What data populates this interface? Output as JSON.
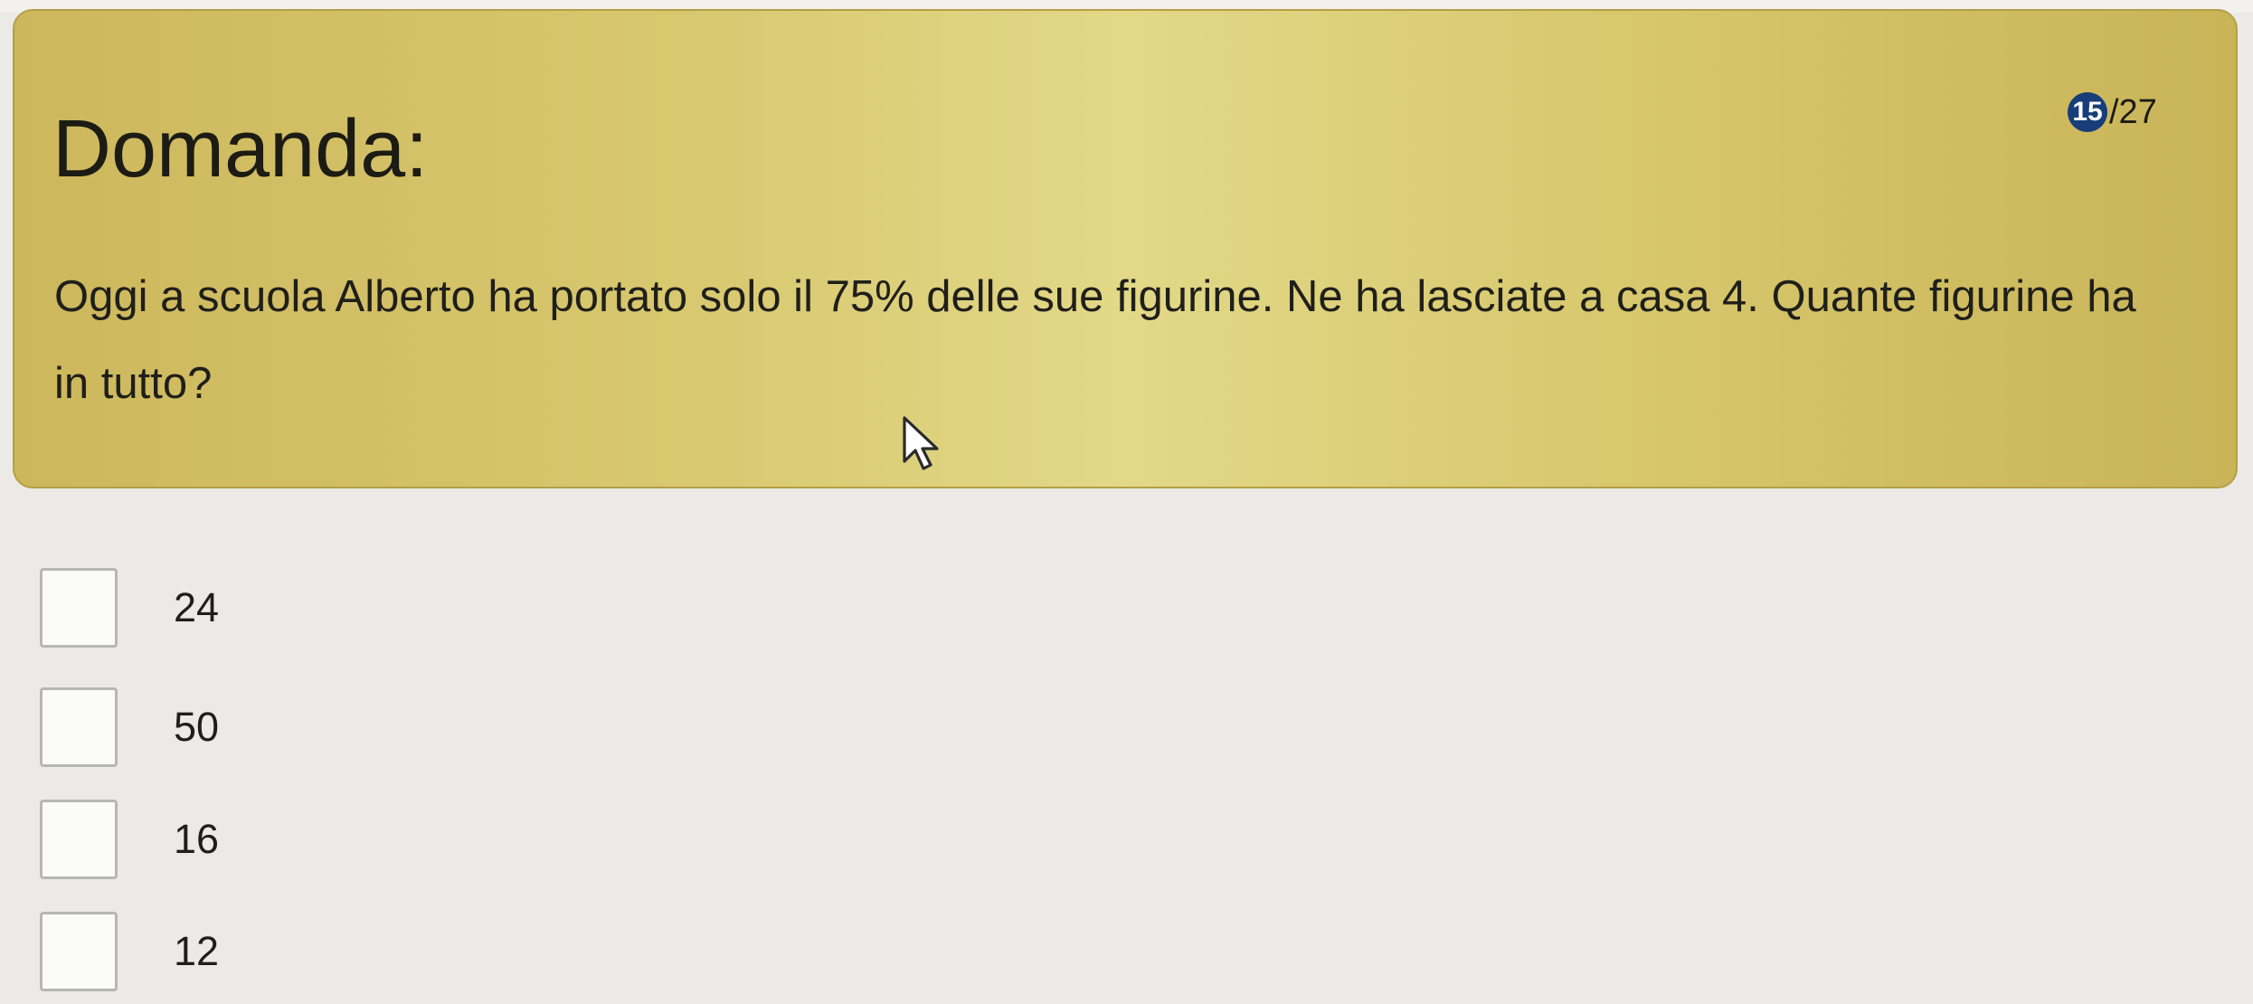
{
  "question": {
    "title": "Domanda:",
    "counter_current": "15",
    "counter_total": "/27",
    "text": "Oggi a scuola Alberto ha portato solo il 75% delle sue figurine. Ne ha lasciate a casa 4. Quante figurine ha in tutto?"
  },
  "options": [
    {
      "label": "24",
      "checked": false
    },
    {
      "label": "50",
      "checked": false
    },
    {
      "label": "16",
      "checked": false
    },
    {
      "label": "12",
      "checked": false
    }
  ],
  "icons": {
    "cursor": "mouse-pointer-icon"
  },
  "colors": {
    "panel_background": "#d8c86f",
    "panel_border": "#b59f45",
    "counter_badge": "#173e7a",
    "page_background": "#eceae6"
  }
}
